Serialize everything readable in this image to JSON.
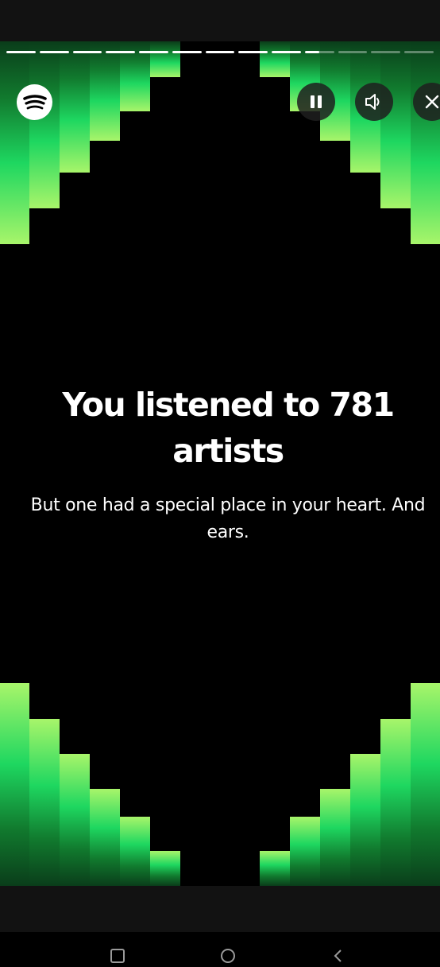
{
  "story": {
    "headline": "You listened to 781 artists",
    "subtext": "But one had a special place in your heart. And ears.",
    "progress_segments": [
      1,
      1,
      1,
      1,
      1,
      1,
      1,
      1,
      1,
      0.5,
      0,
      0,
      0
    ],
    "accent_color": "#1ed760"
  },
  "icons": {
    "logo": "spotify-icon",
    "pause": "pause-icon",
    "sound": "speaker-icon",
    "close": "close-icon",
    "nav": [
      "recent-apps-icon",
      "home-icon",
      "back-icon"
    ]
  }
}
